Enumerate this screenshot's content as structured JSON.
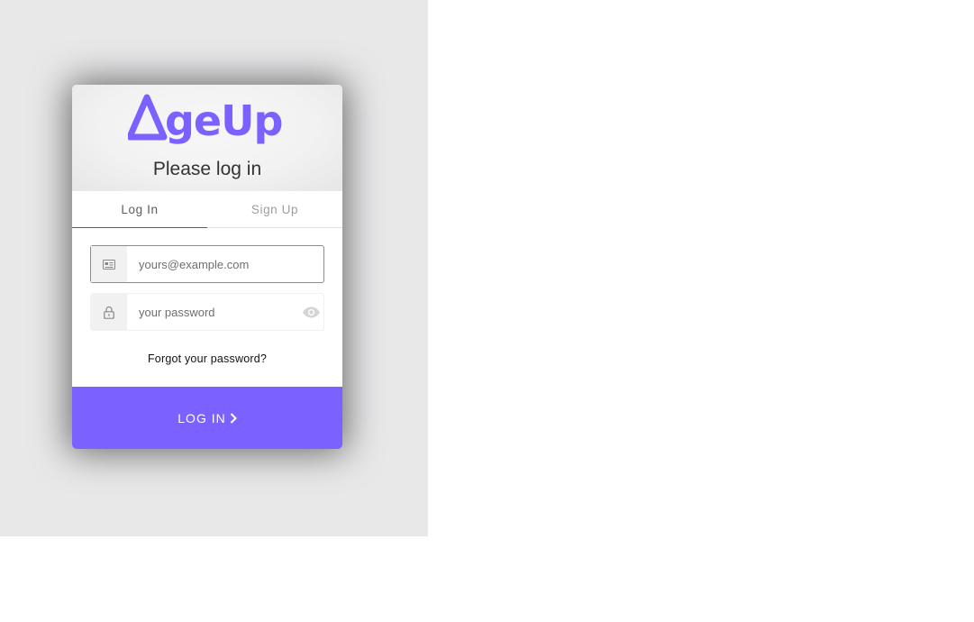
{
  "brand": {
    "logo_text": "AgeUp",
    "accent_color": "#7b61ff"
  },
  "header": {
    "title": "Please log in"
  },
  "tabs": [
    {
      "label": "Log In",
      "active": true
    },
    {
      "label": "Sign Up",
      "active": false
    }
  ],
  "form": {
    "email": {
      "placeholder": "yours@example.com",
      "value": "",
      "icon": "id-card-icon"
    },
    "password": {
      "placeholder": "your password",
      "value": "",
      "icon": "lock-icon",
      "toggle_icon": "eye-icon"
    },
    "forgot_label": "Forgot your password?",
    "submit_label": "LOG IN"
  }
}
